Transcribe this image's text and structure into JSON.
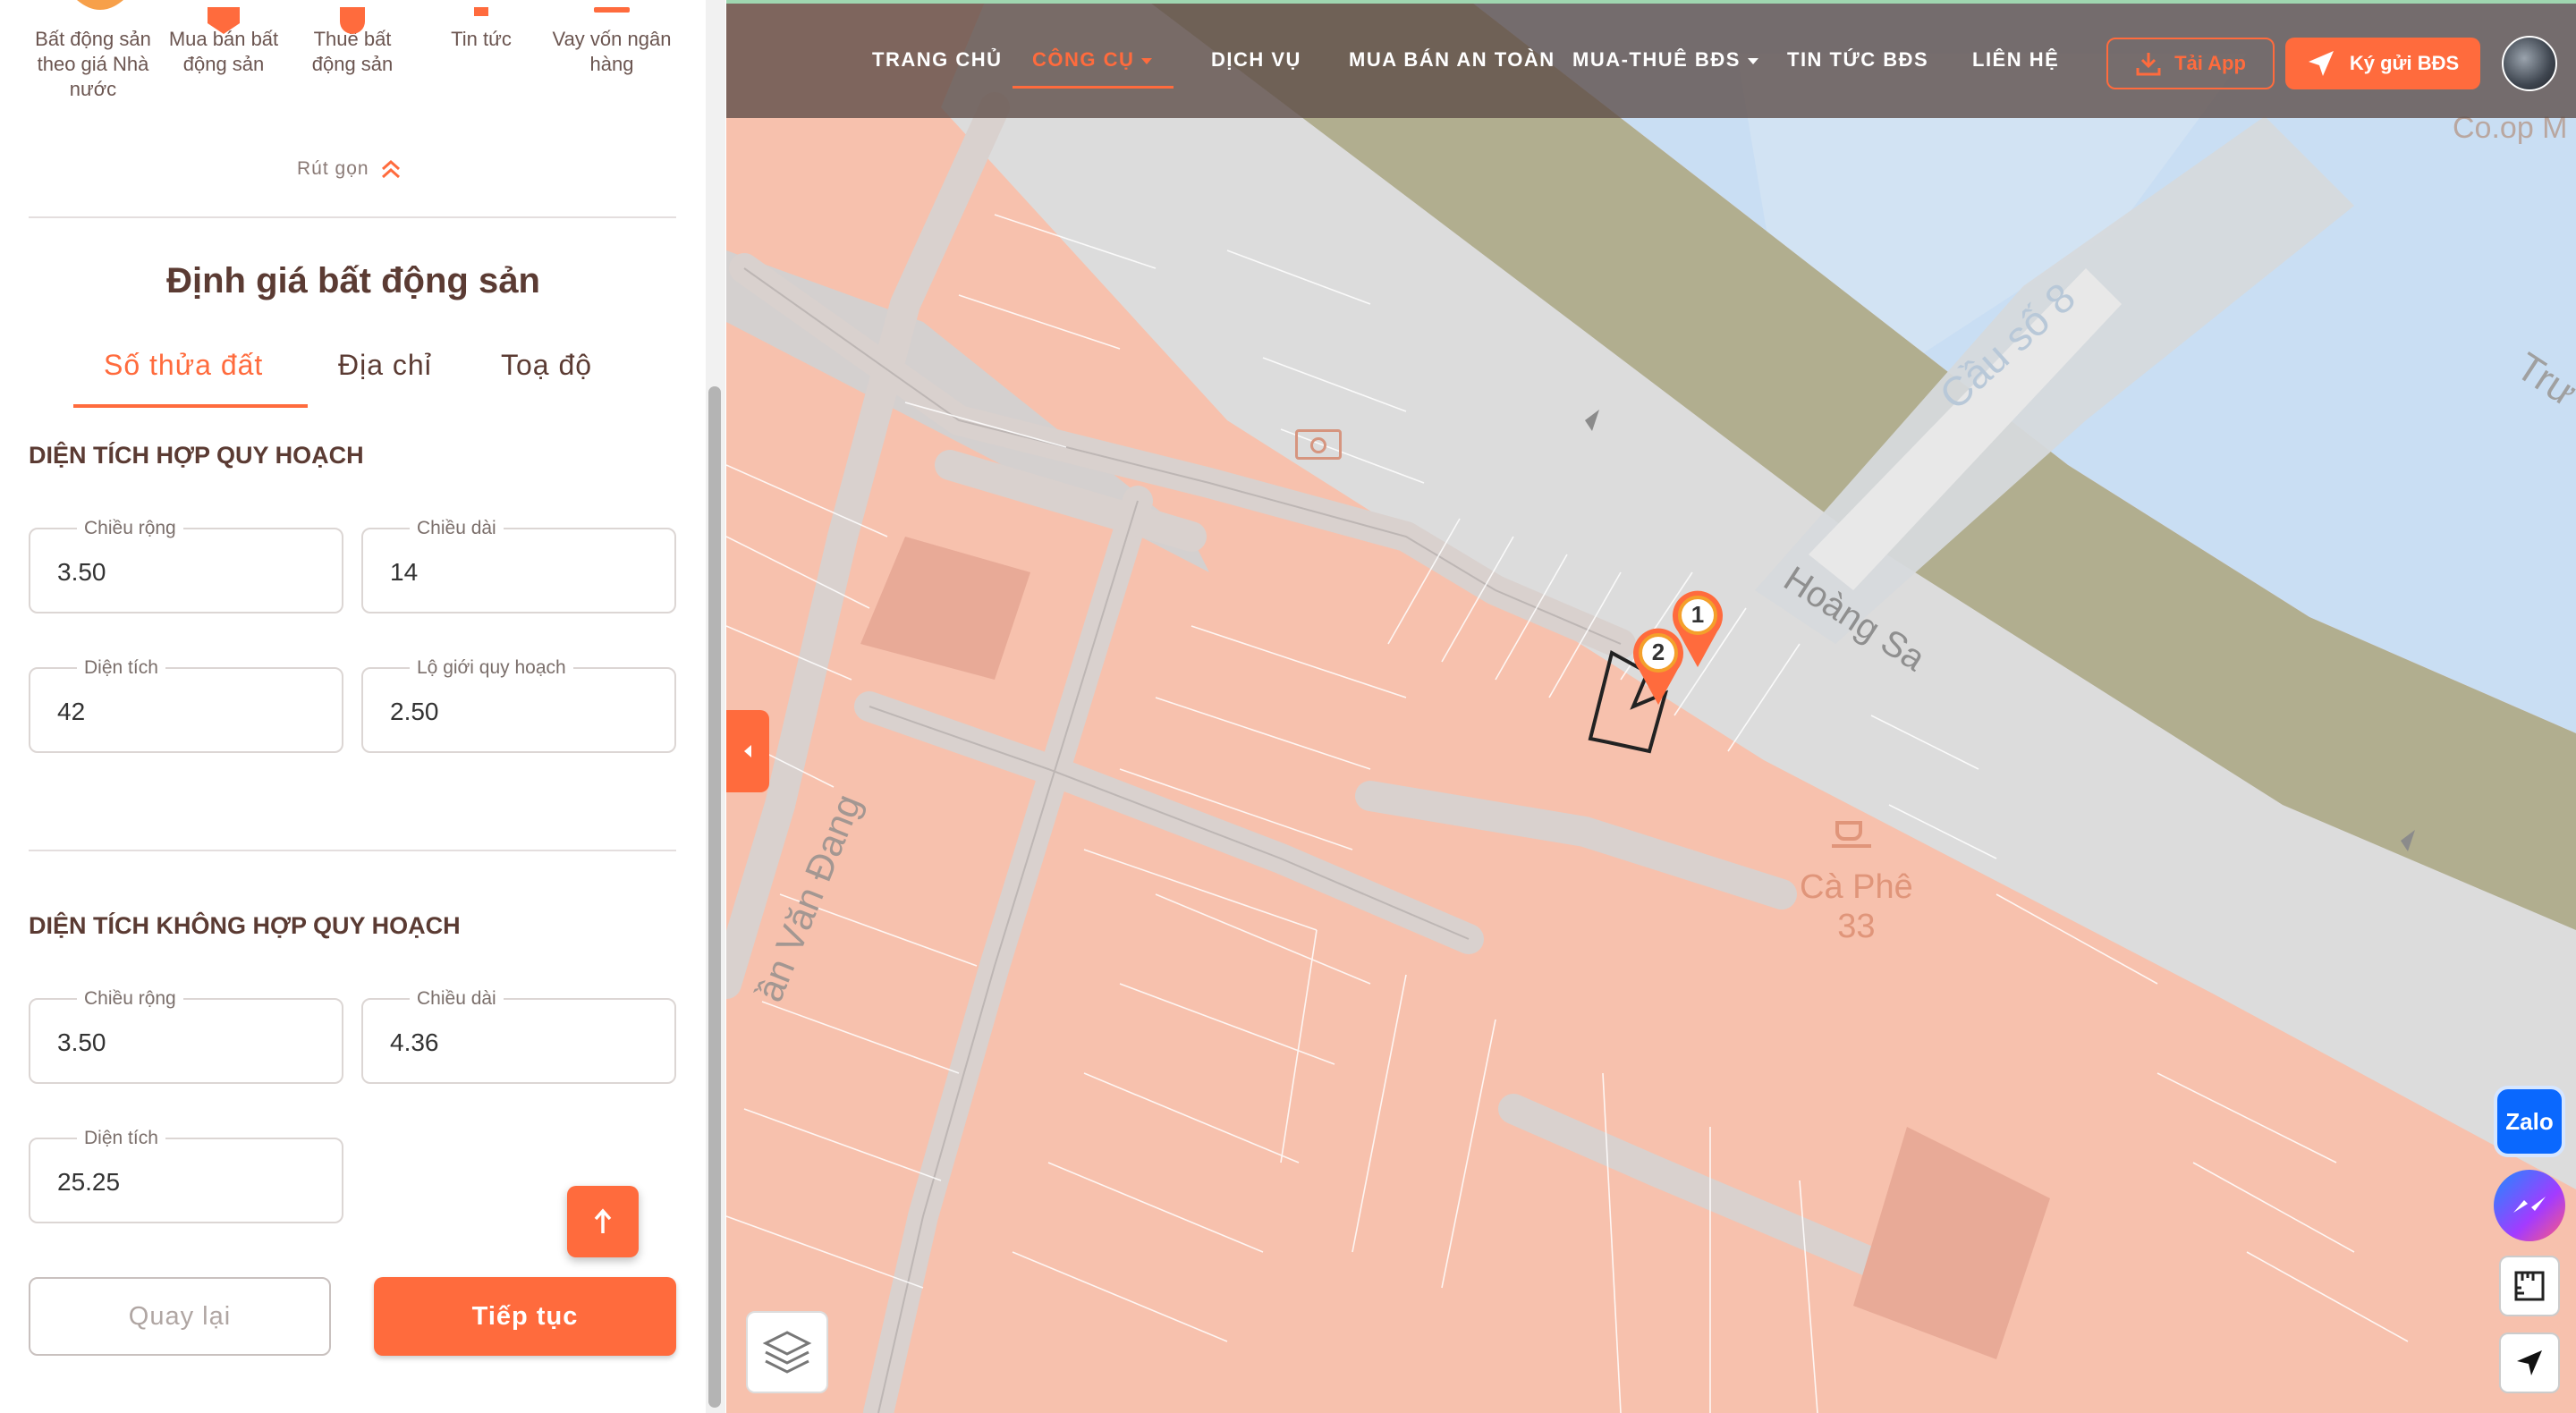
{
  "nav": {
    "items": [
      "TRANG CHỦ",
      "CÔNG CỤ",
      "DỊCH VỤ",
      "MUA BÁN AN TOÀN",
      "MUA-THUÊ BĐS",
      "TIN TỨC BĐS",
      "LIÊN HỆ"
    ],
    "download_label": "Tải App",
    "deposit_label": "Ký gửi BĐS"
  },
  "categories": [
    {
      "label": "Bất động sản theo giá Nhà nước"
    },
    {
      "label": "Mua bán bất động sản"
    },
    {
      "label": "Thuê bất động sản"
    },
    {
      "label": "Tin tức"
    },
    {
      "label": "Vay vốn ngân hàng"
    }
  ],
  "collapse_label": "Rút gọn",
  "panel": {
    "title": "Định giá bất động sản",
    "tabs": [
      "Số thửa đất",
      "Địa chỉ",
      "Toạ độ"
    ],
    "active_tab": 0
  },
  "section_planned": {
    "title": "DIỆN TÍCH HỢP QUY HOẠCH",
    "width_label": "Chiều rộng",
    "width_value": "3.50",
    "length_label": "Chiều dài",
    "length_value": "14",
    "area_label": "Diện tích",
    "area_value": "42",
    "setback_label": "Lộ giới quy hoạch",
    "setback_value": "2.50"
  },
  "section_unplanned": {
    "title": "DIỆN TÍCH KHÔNG HỢP QUY HOẠCH",
    "width_label": "Chiều rộng",
    "width_value": "3.50",
    "length_label": "Chiều dài",
    "length_value": "4.36",
    "area_label": "Diện tích",
    "area_value": "25.25"
  },
  "buttons": {
    "back": "Quay lại",
    "next": "Tiếp tục"
  },
  "map": {
    "labels": {
      "bridge": "Cầu số 8",
      "street1": "Hoàng Sa",
      "street2": "Trư",
      "street3": "ần Văn Đang",
      "cafe_line1": "Cà Phê",
      "cafe_line2": "33",
      "coop": "Co.op M"
    },
    "markers": [
      "1",
      "2"
    ]
  },
  "social": {
    "zalo": "Zalo"
  },
  "colors": {
    "accent": "#ff6b3d",
    "parcel": "#f7c1ad",
    "water": "#c9def3",
    "park": "#b1ae8f"
  }
}
